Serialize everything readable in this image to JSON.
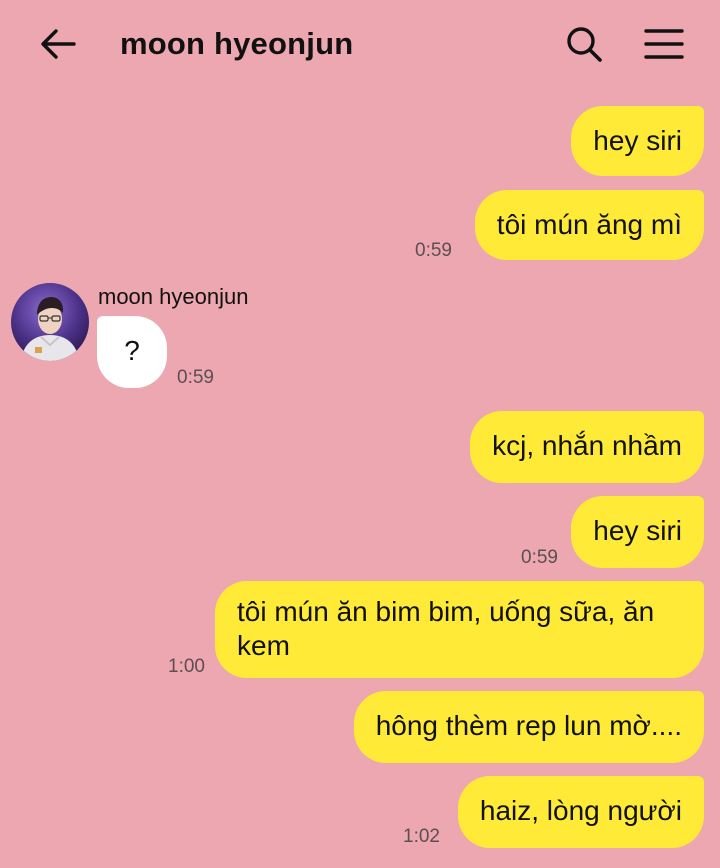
{
  "header": {
    "title": "moon hyeonjun",
    "back_icon": "arrow-left-icon",
    "search_icon": "search-icon",
    "menu_icon": "hamburger-menu-icon"
  },
  "colors": {
    "background": "#EDA7B0",
    "outgoing_bubble": "#FFEA38",
    "incoming_bubble": "#FFFFFF"
  },
  "messages": [
    {
      "direction": "out",
      "text": "hey siri"
    },
    {
      "direction": "out",
      "text": "tôi mún ăng mì",
      "time": "0:59"
    },
    {
      "direction": "in",
      "sender": "moon hyeonjun",
      "text": "?",
      "time": "0:59"
    },
    {
      "direction": "out",
      "text": "kcj, nhắn nhầm"
    },
    {
      "direction": "out",
      "text": "hey siri",
      "time": "0:59"
    },
    {
      "direction": "out",
      "text": "tôi mún ăn bim bim, uống sữa, ăn kem",
      "time": "1:00"
    },
    {
      "direction": "out",
      "text": "hông thèm rep lun mờ...."
    },
    {
      "direction": "out",
      "text": "haiz, lòng người",
      "time": "1:02"
    }
  ]
}
